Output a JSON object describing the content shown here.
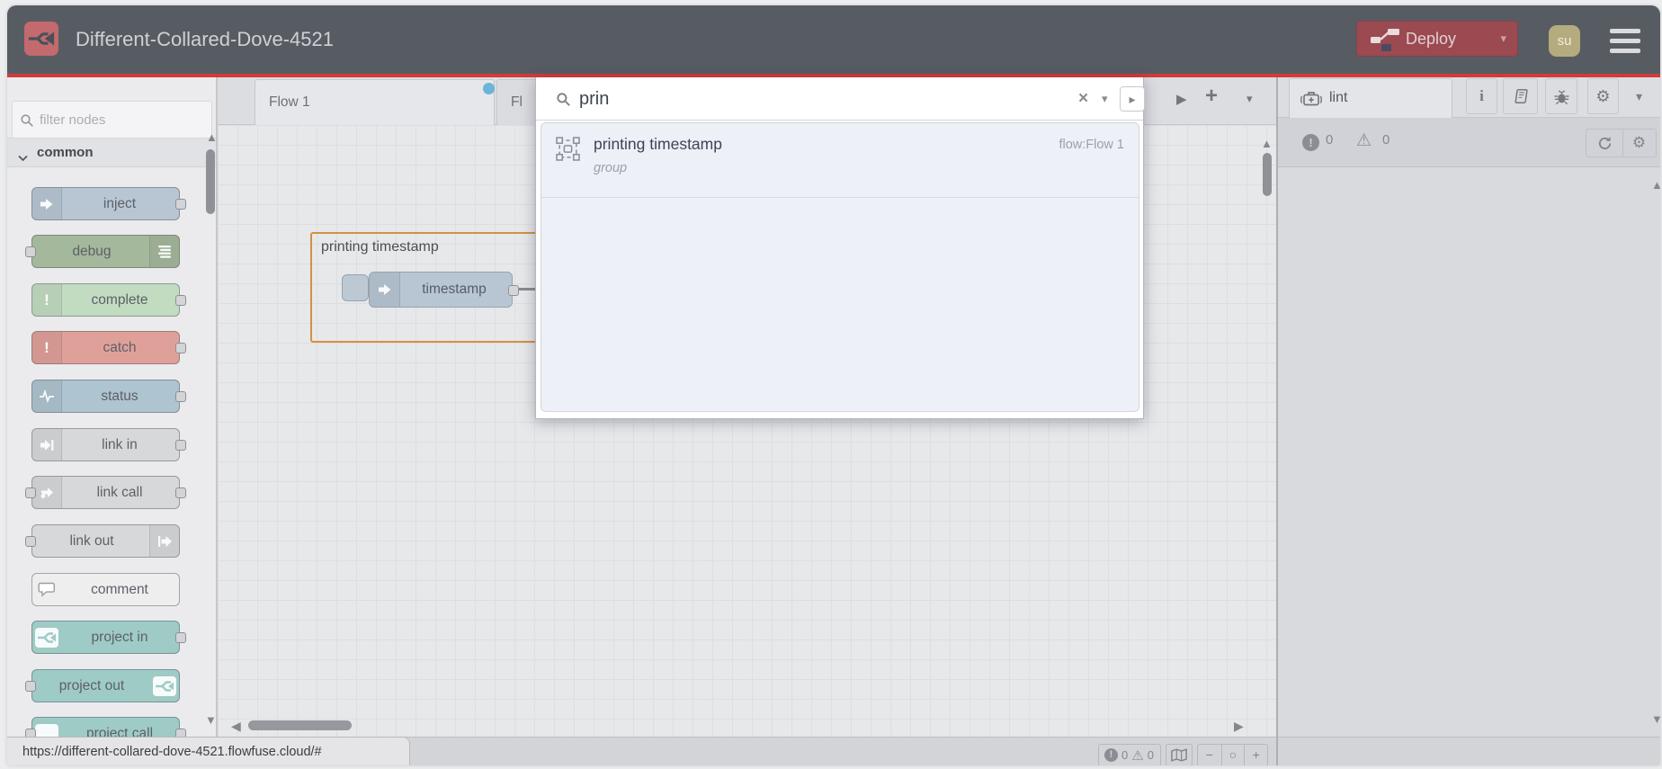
{
  "header": {
    "title": "Different-Collared-Dove-4521",
    "deploy_label": "Deploy",
    "avatar_initials": "su",
    "colors": {
      "header_bg": "#575c63",
      "accent_red": "#d23b3b",
      "logo_red": "#c26a6e",
      "deploy_bg": "#9b4a52",
      "avatar_bg": "#b4ab7e"
    }
  },
  "palette": {
    "filter_placeholder": "filter nodes",
    "category_label": "common",
    "nodes": [
      {
        "label": "inject",
        "color": "#b8c6d4"
      },
      {
        "label": "debug",
        "color": "#a4b89c"
      },
      {
        "label": "complete",
        "color": "#c2dcc2"
      },
      {
        "label": "catch",
        "color": "#e0a09a"
      },
      {
        "label": "status",
        "color": "#aec4d0"
      },
      {
        "label": "link in",
        "color": "#d7d8da"
      },
      {
        "label": "link call",
        "color": "#d7d8da"
      },
      {
        "label": "link out",
        "color": "#d7d8da"
      },
      {
        "label": "comment",
        "color": "#eeeeef"
      },
      {
        "label": "project in",
        "color": "#9ecbc5"
      },
      {
        "label": "project out",
        "color": "#9ecbc5"
      },
      {
        "label": "project call",
        "color": "#9ecbc5"
      }
    ]
  },
  "workspace": {
    "tabs": [
      {
        "label": "Flow 1",
        "modified": true
      },
      {
        "label": "Fl"
      }
    ],
    "group_label": "printing timestamp",
    "inject_node_label": "timestamp"
  },
  "search": {
    "query": "prin",
    "results": [
      {
        "title": "printing timestamp",
        "type": "group",
        "flow": "flow:Flow 1"
      }
    ]
  },
  "sidebar": {
    "active_tab_label": "lint",
    "error_count": "0",
    "warning_count": "0"
  },
  "status_footer": {
    "error_count": "0",
    "warning_count": "0"
  },
  "browser": {
    "link_preview_url": "https://different-collared-dove-4521.flowfuse.cloud/#"
  },
  "icons": {
    "deploy_chevron": "▾",
    "tab_scroll_next": "▶",
    "tab_add": "+",
    "tab_menu": "▾",
    "search_clear": "×",
    "search_type_chevron": "▾",
    "search_open": "▸",
    "sidebar_menu": "▾",
    "zoom_out": "−",
    "zoom_reset": "○",
    "zoom_in": "+",
    "scroll_up": "▲",
    "scroll_down": "▼",
    "scroll_left": "◀",
    "scroll_right": "▶",
    "error_bang": "!"
  }
}
